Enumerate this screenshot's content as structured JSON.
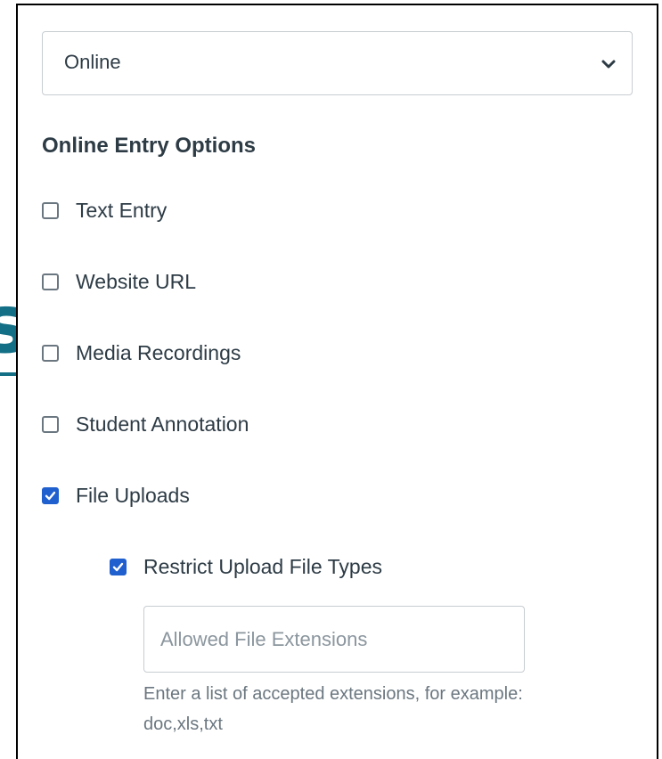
{
  "background_fragment": {
    "text": "s",
    "color": "#136f85"
  },
  "submission_type": {
    "selected": "Online",
    "icon": "chevron-down-icon"
  },
  "online_entry": {
    "title": "Online Entry Options",
    "options": [
      {
        "label": "Text Entry",
        "checked": false
      },
      {
        "label": "Website URL",
        "checked": false
      },
      {
        "label": "Media Recordings",
        "checked": false
      },
      {
        "label": "Student Annotation",
        "checked": false
      },
      {
        "label": "File Uploads",
        "checked": true
      }
    ],
    "restrict_upload": {
      "label": "Restrict Upload File Types",
      "checked": true
    },
    "extensions_input": {
      "value": "",
      "placeholder": "Allowed File Extensions"
    },
    "hint_line_1": "Enter a list of accepted extensions, for example:",
    "hint_line_2": "doc,xls,txt"
  },
  "colors": {
    "accent": "#1f5fce",
    "border": "#c7cdd1",
    "text": "#2d3b45",
    "muted": "#6b7780"
  }
}
